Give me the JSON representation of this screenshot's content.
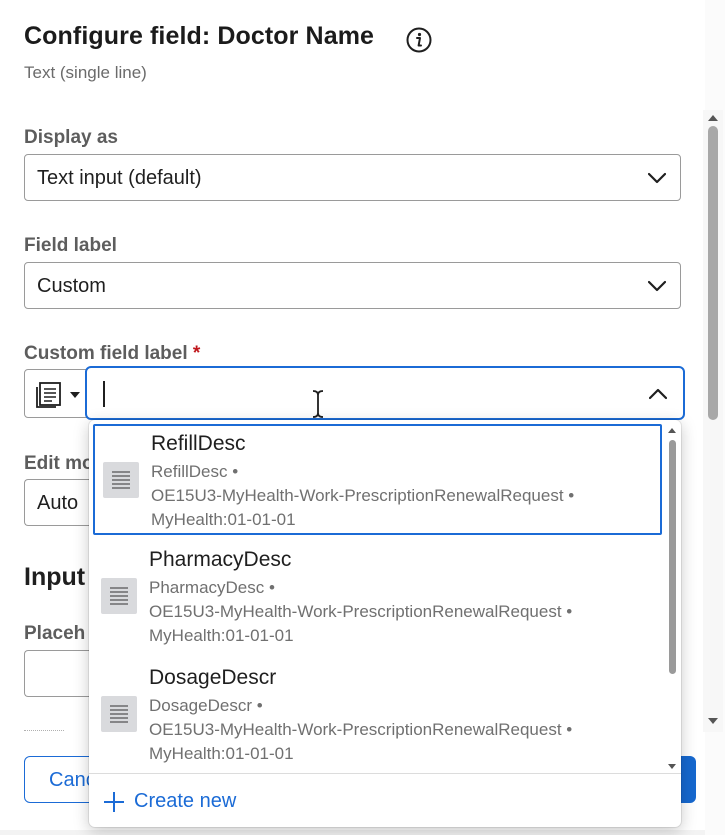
{
  "header": {
    "title": "Configure field: Doctor Name",
    "subtitle": "Text (single line)"
  },
  "display_as": {
    "label": "Display as",
    "value": "Text input (default)"
  },
  "field_label": {
    "label": "Field label",
    "value": "Custom"
  },
  "custom_field_label": {
    "label": "Custom field label",
    "required_mark": "*",
    "input_value": ""
  },
  "partial": {
    "edit_mode_label": "Edit mo",
    "edit_mode_value": "Auto",
    "input_section": "Input",
    "placeholder_label": "Placeh"
  },
  "footer": {
    "cancel_label": "Canc"
  },
  "dropdown": {
    "options": [
      {
        "title": "RefillDesc",
        "line1": "RefillDesc •",
        "line2": "OE15U3-MyHealth-Work-PrescriptionRenewalRequest •",
        "line3": "MyHealth:01-01-01"
      },
      {
        "title": "PharmacyDesc",
        "line1": "PharmacyDesc •",
        "line2": "OE15U3-MyHealth-Work-PrescriptionRenewalRequest •",
        "line3": "MyHealth:01-01-01"
      },
      {
        "title": "DosageDescr",
        "line1": "DosageDescr •",
        "line2": "OE15U3-MyHealth-Work-PrescriptionRenewalRequest •",
        "line3": "MyHealth:01-01-01"
      }
    ],
    "create_new_label": "Create new"
  },
  "colors": {
    "accent": "#1b6bd6",
    "required": "#c0171c",
    "label": "#5d5d5d",
    "meta": "#707070"
  },
  "icons": {
    "info": "info-icon",
    "chevron_down": "chevron-down-icon",
    "chevron_up": "chevron-up-icon",
    "property": "property-list-icon",
    "text_cursor": "text-cursor-icon",
    "plus": "plus-icon"
  }
}
